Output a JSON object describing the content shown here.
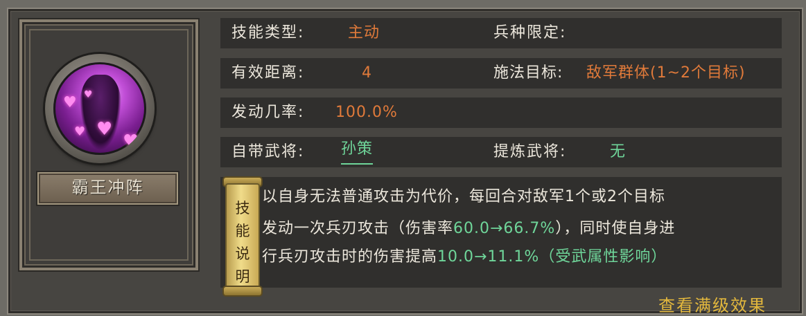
{
  "skill": {
    "name": "霸王冲阵",
    "type_label": "技能类型:",
    "type_value": "主动",
    "troop_label": "兵种限定:",
    "troop_value": "",
    "range_label": "有效距离:",
    "range_value": "4",
    "target_label": "施法目标:",
    "target_value": "敌军群体(1~2个目标)",
    "chance_label": "发动几率:",
    "chance_value": "100.0%",
    "own_general_label": "自带武将:",
    "own_general_value": "孙策",
    "refine_general_label": "提炼武将:",
    "refine_general_value": "无",
    "desc_title": [
      "技",
      "能",
      "说",
      "明"
    ],
    "desc_line1": "以自身无法普通攻击为代价，每回合对敌军1个或2个目标",
    "desc_line2_a": "发动一次兵刃攻击（伤害率",
    "desc_line2_b": "60.0→66.7%",
    "desc_line2_c": "），同时使自身进",
    "desc_line3_a": "行兵刃攻击时的伤害提高",
    "desc_line3_b": "10.0→11.1%（受武属性影响）",
    "footer_link": "查看满级效果"
  },
  "colors": {
    "accent_orange": "#e07a3a",
    "accent_green": "#6fd69a",
    "gold": "#e3b83d"
  }
}
